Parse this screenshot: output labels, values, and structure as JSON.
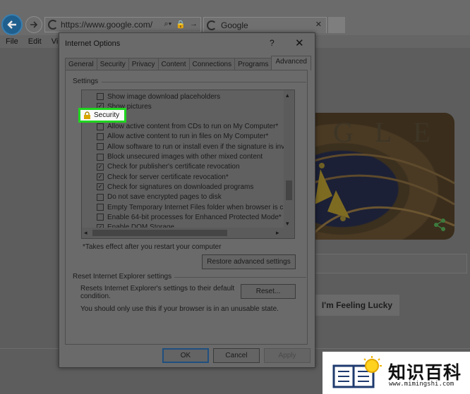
{
  "browser": {
    "address": "https://www.google.com/",
    "tab_title": "Google",
    "menu": [
      "File",
      "Edit",
      "Vi"
    ]
  },
  "page": {
    "doodle_text": "GLE",
    "lucky_button": "I'm Feeling Lucky"
  },
  "dialog": {
    "title": "Internet Options",
    "help": "?",
    "close": "✕",
    "tabs": [
      "General",
      "Security",
      "Privacy",
      "Content",
      "Connections",
      "Programs",
      "Advanced"
    ],
    "active_tab": "Advanced",
    "settings_label": "Settings",
    "settings": [
      {
        "label": "Show image download placeholders",
        "checked": false
      },
      {
        "label": "Show pictures",
        "checked": true
      },
      {
        "label": "Allow active content from CDs to run on My Computer*",
        "checked": false
      },
      {
        "label": "Allow active content to run in files on My Computer*",
        "checked": false
      },
      {
        "label": "Allow software to run or install even if the signature is inva",
        "checked": false
      },
      {
        "label": "Block unsecured images with other mixed content",
        "checked": false
      },
      {
        "label": "Check for publisher's certificate revocation",
        "checked": true
      },
      {
        "label": "Check for server certificate revocation*",
        "checked": true
      },
      {
        "label": "Check for signatures on downloaded programs",
        "checked": true
      },
      {
        "label": "Do not save encrypted pages to disk",
        "checked": false
      },
      {
        "label": "Empty Temporary Internet Files folder when browser is clo",
        "checked": false
      },
      {
        "label": "Enable 64-bit processes for Enhanced Protected Mode*",
        "checked": false
      },
      {
        "label": "Enable DOM Storage",
        "checked": true
      }
    ],
    "highlight_label": "Security",
    "restart_note": "*Takes effect after you restart your computer",
    "restore_button": "Restore advanced settings",
    "reset_group_label": "Reset Internet Explorer settings",
    "reset_desc_1": "Resets Internet Explorer's settings to their default",
    "reset_desc_2": "condition.",
    "reset_button": "Reset...",
    "reset_warning": "You should only use this if your browser is in an unusable state.",
    "ok_button": "OK",
    "cancel_button": "Cancel",
    "apply_button": "Apply"
  },
  "watermark": {
    "title": "知识百科",
    "url": "www.mimingshi.com"
  }
}
